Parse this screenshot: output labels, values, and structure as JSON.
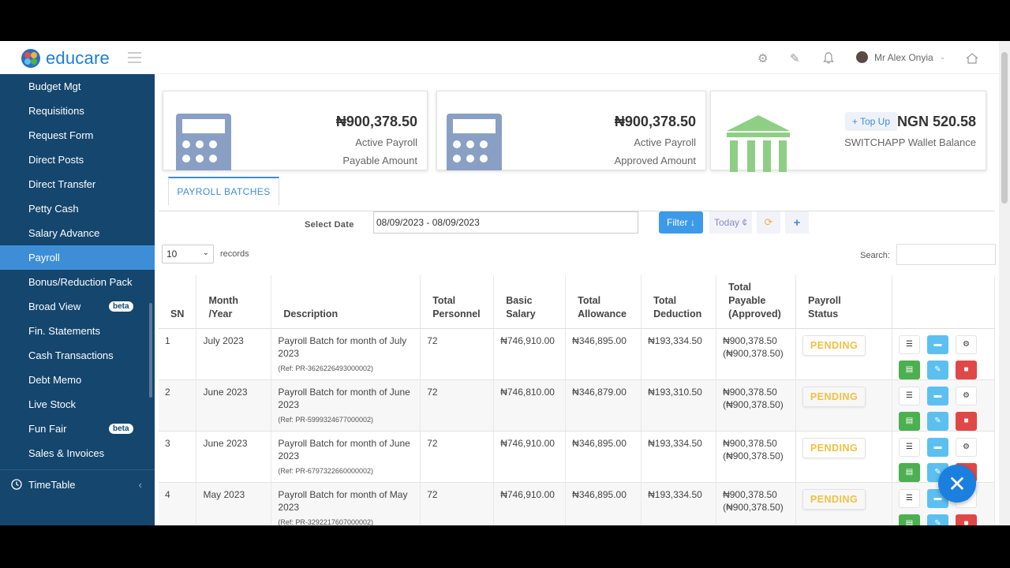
{
  "app": {
    "name": "educare"
  },
  "header": {
    "user_name": "Mr Alex Onyia"
  },
  "sidebar": {
    "items": [
      {
        "label": "Budget Mgt"
      },
      {
        "label": "Requisitions"
      },
      {
        "label": "Request Form"
      },
      {
        "label": "Direct Posts"
      },
      {
        "label": "Direct Transfer"
      },
      {
        "label": "Petty Cash"
      },
      {
        "label": "Salary Advance"
      },
      {
        "label": "Payroll",
        "active": true
      },
      {
        "label": "Bonus/Reduction Pack"
      },
      {
        "label": "Broad View",
        "badge": "beta"
      },
      {
        "label": "Fin. Statements"
      },
      {
        "label": "Cash Transactions"
      },
      {
        "label": "Debt Memo"
      },
      {
        "label": "Live Stock"
      },
      {
        "label": "Fun Fair",
        "badge": "beta"
      },
      {
        "label": "Sales & Invoices"
      }
    ],
    "group_label": "TimeTable"
  },
  "cards": [
    {
      "amount": "₦900,378.50",
      "line1": "Active Payroll",
      "line2": "Payable Amount"
    },
    {
      "amount": "₦900,378.50",
      "line1": "Active Payroll",
      "line2": "Approved Amount"
    },
    {
      "topup_label": "+ Top Up",
      "amount": "NGN 520.58",
      "line1": "SWITCHAPP Wallet Balance"
    }
  ],
  "tab": {
    "label": "PAYROLL BATCHES"
  },
  "filters": {
    "select_date_label": "Select Date",
    "date_range": "08/09/2023 - 08/09/2023",
    "filter_label": "Filter ↓",
    "today_label": "Today ¢",
    "records_value": "10",
    "records_label": "records",
    "search_label": "Search:"
  },
  "table": {
    "headers": {
      "sn": "SN",
      "month_year_1": "Month",
      "month_year_2": "/Year",
      "description": "Description",
      "personnel_1": "Total",
      "personnel_2": "Personnel",
      "basic_1": "Basic",
      "basic_2": "Salary",
      "allowance_1": "Total",
      "allowance_2": "Allowance",
      "deduction_1": "Total",
      "deduction_2": "Deduction",
      "payable_1": "Total",
      "payable_2": "Payable",
      "payable_3": "(Approved)",
      "status_1": "Payroll",
      "status_2": "Status"
    },
    "rows": [
      {
        "sn": "1",
        "month": "July 2023",
        "desc": "Payroll Batch for month of July 2023",
        "ref": "(Ref: PR-3626226493000002)",
        "personnel": "72",
        "basic": "₦746,910.00",
        "allowance": "₦346,895.00",
        "deduction": "₦193,334.50",
        "payable": "₦900,378.50",
        "approved": "(₦900,378.50)",
        "status": "PENDING"
      },
      {
        "sn": "2",
        "month": "June 2023",
        "desc": "Payroll Batch for month of June 2023",
        "ref": "(Ref: PR-5999324677000002)",
        "personnel": "72",
        "basic": "₦746,810.00",
        "allowance": "₦346,879.00",
        "deduction": "₦193,310.50",
        "payable": "₦900,378.50",
        "approved": "(₦900,378.50)",
        "status": "PENDING"
      },
      {
        "sn": "3",
        "month": "June 2023",
        "desc": "Payroll Batch for month of June 2023",
        "ref": "(Ref: PR-6797322660000002)",
        "personnel": "72",
        "basic": "₦746,910.00",
        "allowance": "₦346,895.00",
        "deduction": "₦193,334.50",
        "payable": "₦900,378.50",
        "approved": "(₦900,378.50)",
        "status": "PENDING"
      },
      {
        "sn": "4",
        "month": "May 2023",
        "desc": "Payroll Batch for month of May 2023",
        "ref": "(Ref: PR-3292217607000002)",
        "personnel": "72",
        "basic": "₦746,910.00",
        "allowance": "₦346,895.00",
        "deduction": "₦193,334.50",
        "payable": "₦900,378.50",
        "approved": "(₦900,378.50)",
        "status": "PENDING"
      }
    ]
  },
  "colors": {
    "sidebar": "#14466e",
    "accent": "#3d8ed6",
    "pending": "#f0c040"
  }
}
